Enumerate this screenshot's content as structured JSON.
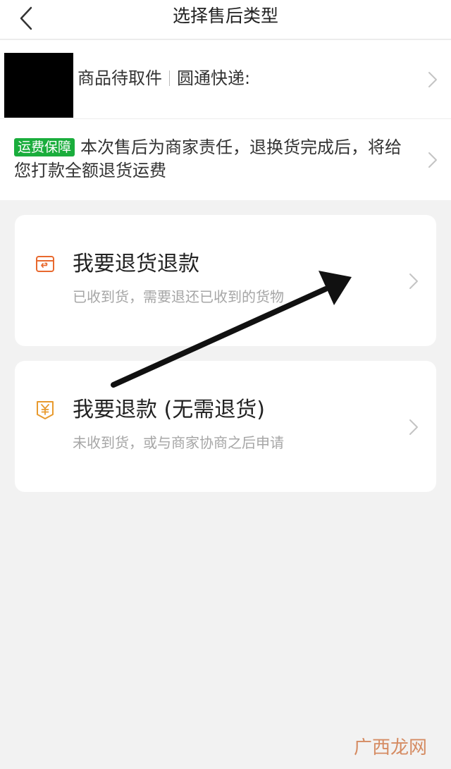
{
  "header": {
    "title": "选择售后类型"
  },
  "shipment": {
    "status": "商品待取件",
    "carrier": "圆通快递:"
  },
  "freight": {
    "badge": "运费保障",
    "text": "本次售后为商家责任，退换货完成后，将给您打款全额退货运费"
  },
  "options": [
    {
      "title": "我要退货退款",
      "subtitle": "已收到货，需要退还已收到的货物",
      "icon": "return-box-icon"
    },
    {
      "title": "我要退款 (无需退货)",
      "subtitle": "未收到货，或与商家协商之后申请",
      "icon": "yuan-refund-icon"
    }
  ],
  "watermark": "广西龙网",
  "colors": {
    "accent": "#e8692e",
    "badge": "#1aad3c",
    "background": "#f2f2f2"
  }
}
